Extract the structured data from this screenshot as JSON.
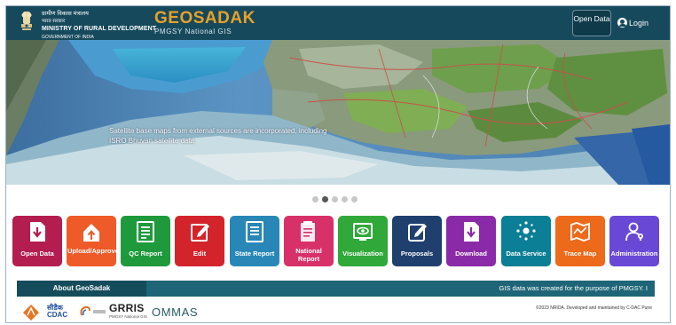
{
  "header": {
    "ministry_hindi": "ग्रामीण विकास मंत्रालय",
    "bharat_sarkar": "भारत सरकार",
    "ministry_english": "MINISTRY OF RURAL DEVELOPMENT",
    "government": "GOVERNMENT OF INDIA",
    "brand_name": "GEOSADAK",
    "brand_subtitle": "PMGSY National GIS",
    "open_data_label": "Open Data",
    "login_label": "Login"
  },
  "hero": {
    "caption_line1": "Satellite base maps from external sources are incorporated, including",
    "caption_line2": "ISRO Bhuvan satellite data",
    "slide_count": 5,
    "active_slide": 2
  },
  "modules": [
    {
      "label": "Open Data",
      "color": "#b31d4f",
      "icon": "download-doc-icon"
    },
    {
      "label": "Upload/Approve",
      "color": "#ee5a28",
      "icon": "upload-home-icon"
    },
    {
      "label": "QC Report",
      "color": "#1e9a3c",
      "icon": "report-icon"
    },
    {
      "label": "Edit",
      "color": "#d3242b",
      "icon": "edit-icon"
    },
    {
      "label": "State Report",
      "color": "#2887b7",
      "icon": "state-report-icon"
    },
    {
      "label": "National Report",
      "color": "#d8316a",
      "icon": "national-report-icon"
    },
    {
      "label": "Visualization",
      "color": "#30a83a",
      "icon": "visualization-icon"
    },
    {
      "label": "Proposals",
      "color": "#1f3f6e",
      "icon": "proposals-icon"
    },
    {
      "label": "Download",
      "color": "#8b2aa8",
      "icon": "download-icon"
    },
    {
      "label": "Data Service",
      "color": "#0b7f95",
      "icon": "data-service-icon"
    },
    {
      "label": "Trace Map",
      "color": "#ec6a1a",
      "icon": "trace-map-icon"
    },
    {
      "label": "Administration",
      "color": "#6a48d6",
      "icon": "administration-icon"
    }
  ],
  "about": {
    "tab_label": "About GeoSadak",
    "ticker_text": "GIS data was created for the purpose of PMGSY. I"
  },
  "footer": {
    "cdac_hindi": "सीडैक",
    "cdac_english": "CDAC",
    "grris_title": "GRRIS",
    "grris_sub": "PMGSY National GIS",
    "ommas": "OMMAS",
    "copyright": "©2023 NRIDA. Developed and maintained by C-DAC Pune"
  }
}
